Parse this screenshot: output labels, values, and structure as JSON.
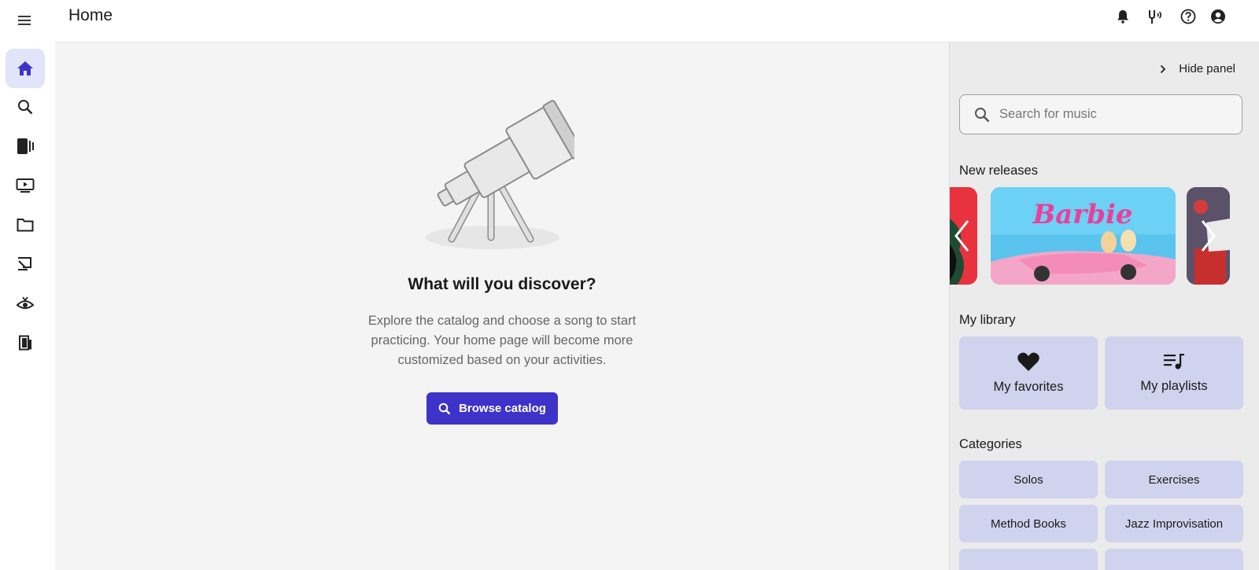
{
  "header": {
    "title": "Home",
    "icons": [
      "bell-icon",
      "tuner-icon",
      "help-icon",
      "account-icon"
    ]
  },
  "rail": {
    "items": [
      {
        "name": "home",
        "icon": "home-icon",
        "active": true
      },
      {
        "name": "search",
        "icon": "search-icon"
      },
      {
        "name": "library",
        "icon": "library-icon"
      },
      {
        "name": "videos",
        "icon": "video-icon"
      },
      {
        "name": "files",
        "icon": "folder-icon"
      },
      {
        "name": "assignments",
        "icon": "assignment-icon"
      },
      {
        "name": "sight-reading",
        "icon": "eye-icon"
      },
      {
        "name": "exit",
        "icon": "door-icon"
      }
    ]
  },
  "main": {
    "heading": "What will you discover?",
    "description": "Explore the catalog and choose a song to start practicing. Your home page will become more customized based on your activities.",
    "browse_label": "Browse catalog"
  },
  "panel": {
    "hide_label": "Hide panel",
    "search_placeholder": "Search for music",
    "new_releases_title": "New releases",
    "releases": [
      {
        "title_art": "Barbie"
      }
    ],
    "library_title": "My library",
    "library": [
      {
        "label": "My favorites",
        "icon": "heart-icon"
      },
      {
        "label": "My playlists",
        "icon": "playlist-icon"
      }
    ],
    "categories_title": "Categories",
    "categories": [
      "Solos",
      "Exercises",
      "Method Books",
      "Jazz Improvisation"
    ]
  },
  "colors": {
    "accent": "#3e33c9",
    "tile": "#d0d3ee",
    "active_nav": "#e2e4fa",
    "main_bg": "#f4f4f4",
    "panel_bg": "#ebebeb"
  }
}
